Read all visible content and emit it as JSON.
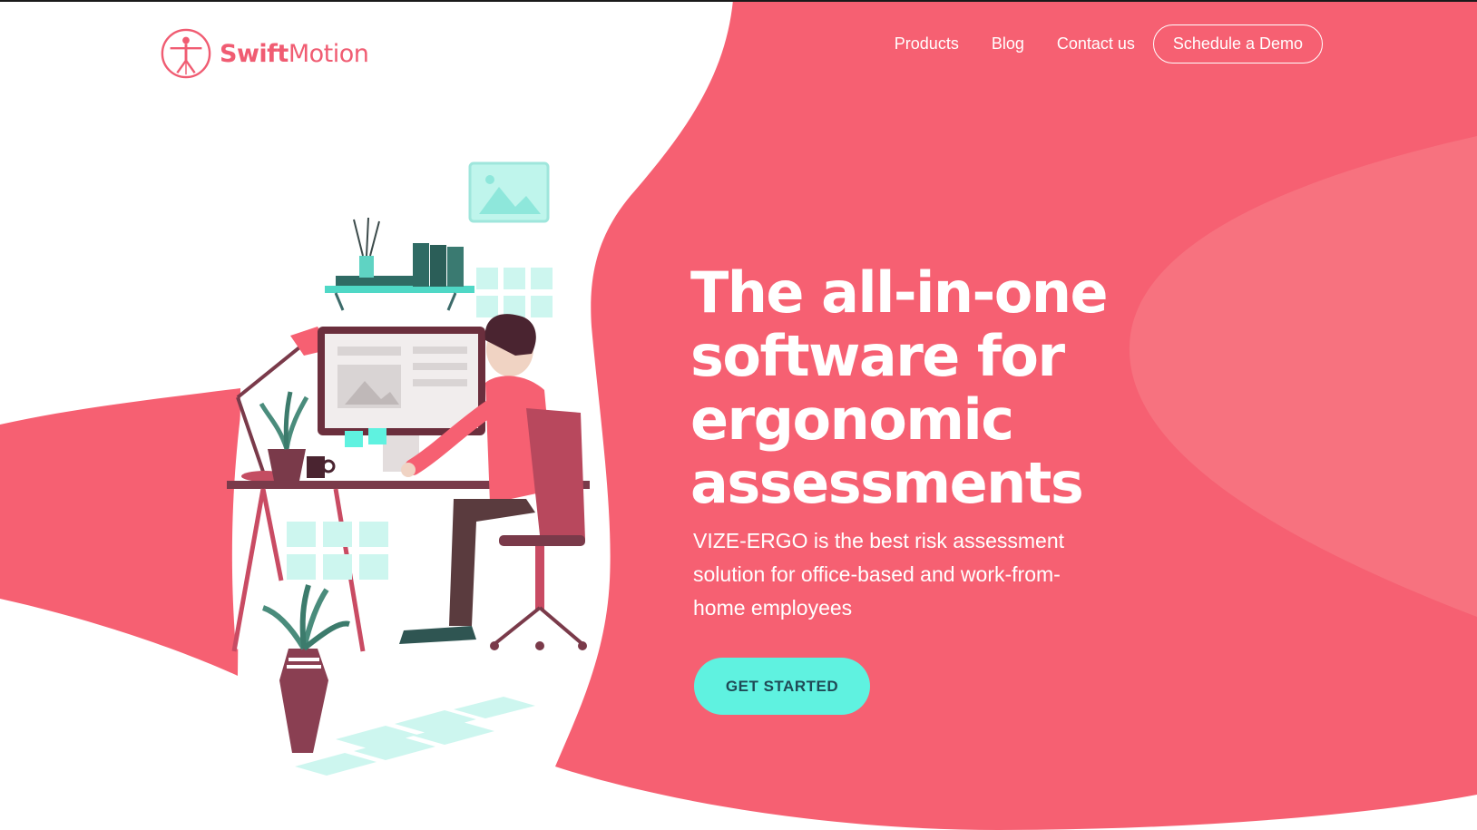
{
  "brand": {
    "name_bold": "Swift",
    "name_light": "Motion",
    "logo_icon": "vitruvian-man-icon"
  },
  "nav": {
    "items": [
      {
        "label": "Products"
      },
      {
        "label": "Blog"
      },
      {
        "label": "Contact us"
      }
    ],
    "cta_label": "Schedule a Demo"
  },
  "hero": {
    "title": "The all-in-one software for ergonomic assessments",
    "subtitle": "VIZE-ERGO is the best risk assessment solution for office-based and work-from-home employees",
    "cta_label": "GET STARTED"
  },
  "colors": {
    "brand_coral": "#f66072",
    "light_coral": "#f7727f",
    "teal_accent": "#5ff2e0",
    "dark_plum": "#7a3a4a"
  },
  "illustration": {
    "subject": "person-at-desk-illustration"
  }
}
